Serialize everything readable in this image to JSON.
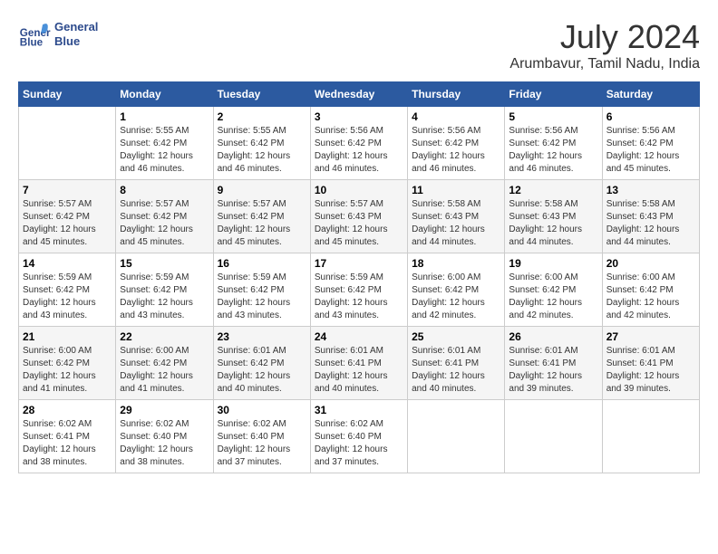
{
  "header": {
    "logo_line1": "General",
    "logo_line2": "Blue",
    "month": "July 2024",
    "location": "Arumbavur, Tamil Nadu, India"
  },
  "weekdays": [
    "Sunday",
    "Monday",
    "Tuesday",
    "Wednesday",
    "Thursday",
    "Friday",
    "Saturday"
  ],
  "weeks": [
    [
      {
        "day": "",
        "text": ""
      },
      {
        "day": "1",
        "text": "Sunrise: 5:55 AM\nSunset: 6:42 PM\nDaylight: 12 hours\nand 46 minutes."
      },
      {
        "day": "2",
        "text": "Sunrise: 5:55 AM\nSunset: 6:42 PM\nDaylight: 12 hours\nand 46 minutes."
      },
      {
        "day": "3",
        "text": "Sunrise: 5:56 AM\nSunset: 6:42 PM\nDaylight: 12 hours\nand 46 minutes."
      },
      {
        "day": "4",
        "text": "Sunrise: 5:56 AM\nSunset: 6:42 PM\nDaylight: 12 hours\nand 46 minutes."
      },
      {
        "day": "5",
        "text": "Sunrise: 5:56 AM\nSunset: 6:42 PM\nDaylight: 12 hours\nand 46 minutes."
      },
      {
        "day": "6",
        "text": "Sunrise: 5:56 AM\nSunset: 6:42 PM\nDaylight: 12 hours\nand 45 minutes."
      }
    ],
    [
      {
        "day": "7",
        "text": "Sunrise: 5:57 AM\nSunset: 6:42 PM\nDaylight: 12 hours\nand 45 minutes."
      },
      {
        "day": "8",
        "text": "Sunrise: 5:57 AM\nSunset: 6:42 PM\nDaylight: 12 hours\nand 45 minutes."
      },
      {
        "day": "9",
        "text": "Sunrise: 5:57 AM\nSunset: 6:42 PM\nDaylight: 12 hours\nand 45 minutes."
      },
      {
        "day": "10",
        "text": "Sunrise: 5:57 AM\nSunset: 6:43 PM\nDaylight: 12 hours\nand 45 minutes."
      },
      {
        "day": "11",
        "text": "Sunrise: 5:58 AM\nSunset: 6:43 PM\nDaylight: 12 hours\nand 44 minutes."
      },
      {
        "day": "12",
        "text": "Sunrise: 5:58 AM\nSunset: 6:43 PM\nDaylight: 12 hours\nand 44 minutes."
      },
      {
        "day": "13",
        "text": "Sunrise: 5:58 AM\nSunset: 6:43 PM\nDaylight: 12 hours\nand 44 minutes."
      }
    ],
    [
      {
        "day": "14",
        "text": "Sunrise: 5:59 AM\nSunset: 6:42 PM\nDaylight: 12 hours\nand 43 minutes."
      },
      {
        "day": "15",
        "text": "Sunrise: 5:59 AM\nSunset: 6:42 PM\nDaylight: 12 hours\nand 43 minutes."
      },
      {
        "day": "16",
        "text": "Sunrise: 5:59 AM\nSunset: 6:42 PM\nDaylight: 12 hours\nand 43 minutes."
      },
      {
        "day": "17",
        "text": "Sunrise: 5:59 AM\nSunset: 6:42 PM\nDaylight: 12 hours\nand 43 minutes."
      },
      {
        "day": "18",
        "text": "Sunrise: 6:00 AM\nSunset: 6:42 PM\nDaylight: 12 hours\nand 42 minutes."
      },
      {
        "day": "19",
        "text": "Sunrise: 6:00 AM\nSunset: 6:42 PM\nDaylight: 12 hours\nand 42 minutes."
      },
      {
        "day": "20",
        "text": "Sunrise: 6:00 AM\nSunset: 6:42 PM\nDaylight: 12 hours\nand 42 minutes."
      }
    ],
    [
      {
        "day": "21",
        "text": "Sunrise: 6:00 AM\nSunset: 6:42 PM\nDaylight: 12 hours\nand 41 minutes."
      },
      {
        "day": "22",
        "text": "Sunrise: 6:00 AM\nSunset: 6:42 PM\nDaylight: 12 hours\nand 41 minutes."
      },
      {
        "day": "23",
        "text": "Sunrise: 6:01 AM\nSunset: 6:42 PM\nDaylight: 12 hours\nand 40 minutes."
      },
      {
        "day": "24",
        "text": "Sunrise: 6:01 AM\nSunset: 6:41 PM\nDaylight: 12 hours\nand 40 minutes."
      },
      {
        "day": "25",
        "text": "Sunrise: 6:01 AM\nSunset: 6:41 PM\nDaylight: 12 hours\nand 40 minutes."
      },
      {
        "day": "26",
        "text": "Sunrise: 6:01 AM\nSunset: 6:41 PM\nDaylight: 12 hours\nand 39 minutes."
      },
      {
        "day": "27",
        "text": "Sunrise: 6:01 AM\nSunset: 6:41 PM\nDaylight: 12 hours\nand 39 minutes."
      }
    ],
    [
      {
        "day": "28",
        "text": "Sunrise: 6:02 AM\nSunset: 6:41 PM\nDaylight: 12 hours\nand 38 minutes."
      },
      {
        "day": "29",
        "text": "Sunrise: 6:02 AM\nSunset: 6:40 PM\nDaylight: 12 hours\nand 38 minutes."
      },
      {
        "day": "30",
        "text": "Sunrise: 6:02 AM\nSunset: 6:40 PM\nDaylight: 12 hours\nand 37 minutes."
      },
      {
        "day": "31",
        "text": "Sunrise: 6:02 AM\nSunset: 6:40 PM\nDaylight: 12 hours\nand 37 minutes."
      },
      {
        "day": "",
        "text": ""
      },
      {
        "day": "",
        "text": ""
      },
      {
        "day": "",
        "text": ""
      }
    ]
  ]
}
